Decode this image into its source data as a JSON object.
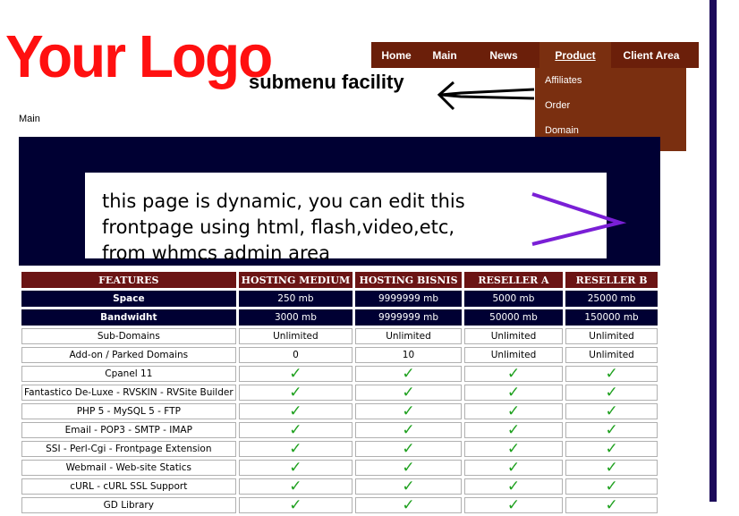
{
  "logo": {
    "text": "Your Logo"
  },
  "annotation": {
    "submenu_note": "submenu facility"
  },
  "nav": {
    "items": [
      {
        "label": "Home"
      },
      {
        "label": "Main"
      },
      {
        "label": "News"
      },
      {
        "label": "Product"
      },
      {
        "label": "Client Area"
      }
    ],
    "active": "Product"
  },
  "dropdown": {
    "items": [
      "Affiliates",
      "Order",
      "Domain"
    ]
  },
  "breadcrumb": {
    "text": "Main"
  },
  "banner": {
    "line1": "this page is dynamic, you can edit this",
    "line2": "frontpage using html, flash,video,etc,",
    "line3": "from whmcs admin area"
  },
  "table": {
    "headers": [
      "FEATURES",
      "HOSTING MEDIUM",
      "HOSTING BISNIS",
      "RESELLER A",
      "RESELLER B"
    ],
    "value_rows": [
      {
        "feature": "Space",
        "values": [
          "250 mb",
          "9999999 mb",
          "5000 mb",
          "25000 mb"
        ]
      },
      {
        "feature": "Bandwidht",
        "values": [
          "3000 mb",
          "9999999 mb",
          "50000 mb",
          "150000 mb"
        ]
      },
      {
        "feature": "Sub-Domains",
        "values": [
          "Unlimited",
          "Unlimited",
          "Unlimited",
          "Unlimited"
        ]
      },
      {
        "feature": "Add-on / Parked Domains",
        "values": [
          "0",
          "10",
          "Unlimited",
          "Unlimited"
        ]
      }
    ],
    "check_rows": [
      "Cpanel 11",
      "Fantastico De-Luxe - RVSKIN - RVSite Builder",
      "PHP 5 - MySQL 5 - FTP",
      "Email - POP3 - SMTP - IMAP",
      "SSI - Perl-Cgi - Frontpage Extension",
      "Webmail - Web-site Statics",
      "cURL - cURL SSL Support",
      "GD Library"
    ],
    "check_glyph": "✓"
  },
  "colors": {
    "logo": "#ff1010",
    "nav_bg": "#6b1f0a",
    "dropdown_bg": "#7a2f10",
    "banner_bg": "#000033",
    "header_bg": "#6b1414",
    "check": "#1ea01e",
    "arrow": "#7a1fd6"
  }
}
